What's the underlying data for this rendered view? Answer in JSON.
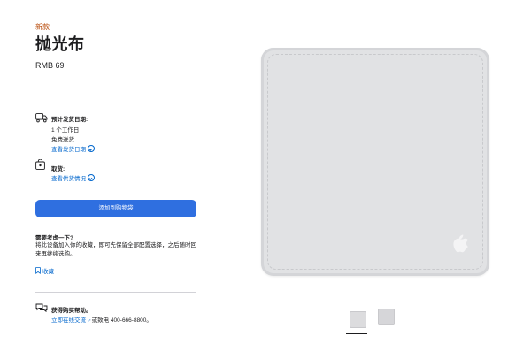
{
  "product": {
    "badge": "新款",
    "title": "抛光布",
    "price": "RMB 69"
  },
  "delivery": {
    "label": "预计发货日期:",
    "line1": "1 个工作日",
    "line2": "免费送货",
    "link": "查看发货日期"
  },
  "pickup": {
    "label": "取货:",
    "link": "查看供货情况"
  },
  "cta": {
    "add_to_bag": "添加到购物袋"
  },
  "consider": {
    "title": "需要考虑一下?",
    "text": "将此设备加入你的收藏，即可先保留全部配置选择，之后随时回来再继续选购。",
    "save_label": "收藏"
  },
  "help": {
    "title": "获得购买帮助。",
    "chat_link": "立即在线交流",
    "call_text": "或致电 400-666-8800。"
  },
  "gallery": {
    "thumbnails": [
      "thumbnail-1",
      "thumbnail-2"
    ],
    "selected_index": 0
  },
  "colors": {
    "accent": "#2f6fe0",
    "link": "#0066cc",
    "badge": "#b64400",
    "product": "#e1e2e4"
  }
}
